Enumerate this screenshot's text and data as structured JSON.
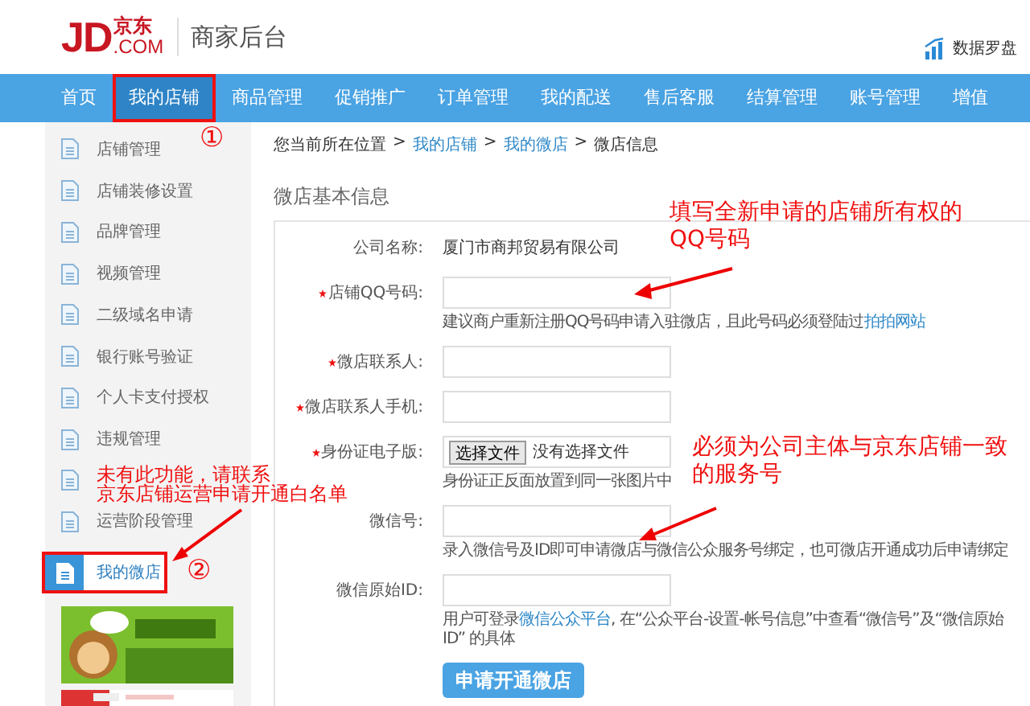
{
  "header": {
    "logo": {
      "latin": "JD",
      "domain": ".COM",
      "cn": "京东"
    },
    "title": "商家后台",
    "data_link": "数据罗盘"
  },
  "nav": [
    {
      "label": "首页",
      "selected": false,
      "highlighted": false
    },
    {
      "label": "我的店铺",
      "selected": true,
      "highlighted": true
    },
    {
      "label": "商品管理",
      "selected": false,
      "highlighted": false
    },
    {
      "label": "促销推广",
      "selected": false,
      "highlighted": false
    },
    {
      "label": "订单管理",
      "selected": false,
      "highlighted": false
    },
    {
      "label": "我的配送",
      "selected": false,
      "highlighted": false
    },
    {
      "label": "售后客服",
      "selected": false,
      "highlighted": false
    },
    {
      "label": "结算管理",
      "selected": false,
      "highlighted": false
    },
    {
      "label": "账号管理",
      "selected": false,
      "highlighted": false
    },
    {
      "label": "增值",
      "selected": false,
      "highlighted": false
    }
  ],
  "sidebar": {
    "items": [
      {
        "label": "店铺管理",
        "selected": false,
        "highlighted": false
      },
      {
        "label": "店铺装修设置",
        "selected": false,
        "highlighted": false
      },
      {
        "label": "品牌管理",
        "selected": false,
        "highlighted": false
      },
      {
        "label": "视频管理",
        "selected": false,
        "highlighted": false
      },
      {
        "label": "二级域名申请",
        "selected": false,
        "highlighted": false
      },
      {
        "label": "银行账号验证",
        "selected": false,
        "highlighted": false
      },
      {
        "label": "个人卡支付授权",
        "selected": false,
        "highlighted": false
      },
      {
        "label": "违规管理",
        "selected": false,
        "highlighted": false
      },
      {
        "selected": false,
        "highlighted": false
      },
      {
        "label": "运营阶段管理",
        "selected": false,
        "highlighted": false
      },
      {
        "label": "我的微店",
        "selected": true,
        "highlighted": true
      }
    ]
  },
  "breadcrumb": [
    {
      "label": "您当前所在位置",
      "link": false
    },
    {
      "sep": ">",
      "label": "我的店铺",
      "link": true
    },
    {
      "sep": ">",
      "label": "我的微店",
      "link": true
    },
    {
      "sep": ">",
      "label": "微店信息",
      "link": false
    }
  ],
  "form": {
    "title": "微店基本信息",
    "rows": [
      {
        "kind": "text",
        "label": "公司名称:",
        "required": false,
        "value": "厦门市商邦贸易有限公司"
      },
      {
        "kind": "input",
        "label": "店铺QQ号码:",
        "required": true
      },
      {
        "kind": "hint",
        "parts": [
          {
            "text": "建议商户重新注册QQ号码申请入驻微店，且此号码必须登陆过",
            "link": false
          },
          {
            "text": "拍拍网站",
            "link": true
          }
        ]
      },
      {
        "kind": "input",
        "label": "微店联系人:",
        "required": true
      },
      {
        "kind": "input",
        "label": "微店联系人手机:",
        "required": true
      },
      {
        "kind": "file",
        "label": "身份证电子版:",
        "required": true,
        "button": "选择文件",
        "status": "没有选择文件"
      },
      {
        "kind": "hint",
        "parts": [
          {
            "text": "身份证正反面放置到同一张图片中",
            "link": false
          }
        ]
      },
      {
        "kind": "input",
        "label": "微信号:",
        "required": false
      },
      {
        "kind": "hint",
        "parts": [
          {
            "text": "录入微信号及ID即可申请微店与微信公众服务号绑定，也可微店开通成功后申请绑定",
            "link": false
          }
        ]
      },
      {
        "kind": "input",
        "label": "微信原始ID:",
        "required": false
      },
      {
        "kind": "hint",
        "parts": [
          {
            "text": "用户可登录",
            "link": false
          },
          {
            "text": "微信公众平台",
            "link": true
          },
          {
            "text": ", 在“公众平台-设置-帐号信息”中查看“微信号”及“微信原始ID” 的具体",
            "link": false
          }
        ]
      }
    ],
    "submit": "申请开通微店"
  },
  "annotations": [
    {
      "kind": "marker",
      "text": "①"
    },
    {
      "kind": "note",
      "lines": [
        "填写全新申请的店铺所有权的",
        "QQ号码"
      ]
    },
    {
      "kind": "note",
      "lines": [
        "必须为公司主体与京东店铺一致",
        "的服务号"
      ]
    },
    {
      "kind": "note",
      "lines": [
        "未有此功能，请联系",
        "京东店铺运营申请开通白名单"
      ]
    },
    {
      "kind": "marker",
      "text": "②"
    }
  ]
}
